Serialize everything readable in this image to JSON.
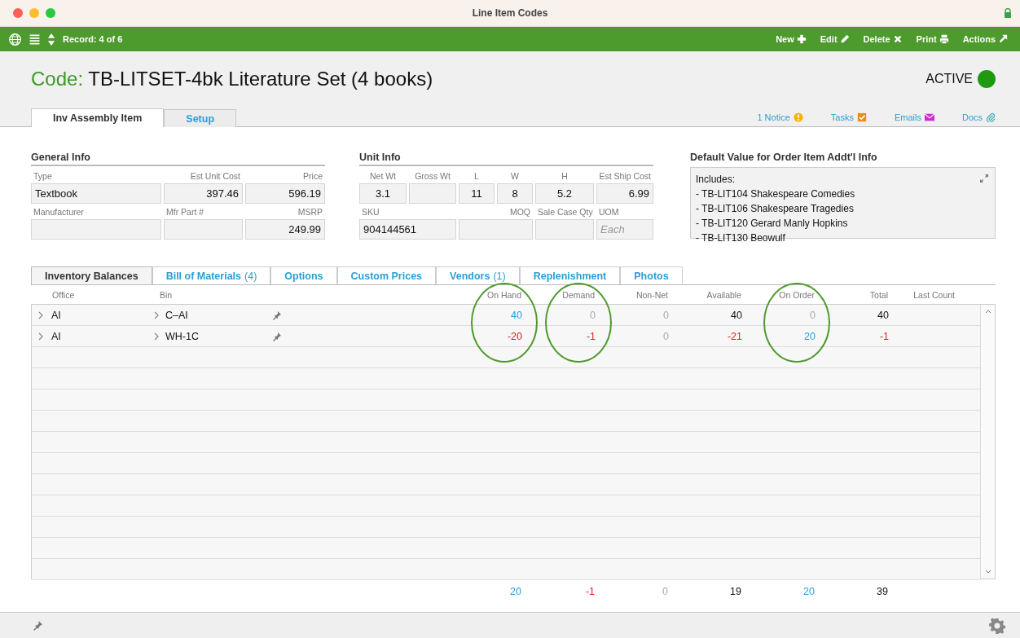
{
  "window": {
    "title": "Line Item Codes"
  },
  "toolbar": {
    "record": "Record: 4 of 6",
    "actions": [
      {
        "label": "New",
        "kind": "new"
      },
      {
        "label": "Edit",
        "kind": "edit"
      },
      {
        "label": "Delete",
        "kind": "delete"
      },
      {
        "label": "Print",
        "kind": "print"
      },
      {
        "label": "Actions",
        "kind": "actions"
      }
    ]
  },
  "header": {
    "code_label": "Code:",
    "title": "TB-LITSET-4bk Literature Set (4 books)",
    "status": {
      "label": "ACTIVE",
      "on": true
    }
  },
  "tabs": [
    {
      "label": "Inv Assembly Item",
      "selected": true
    },
    {
      "label": "Setup",
      "selected": false
    }
  ],
  "links": [
    {
      "label": "1 Notice",
      "kind": "notice"
    },
    {
      "label": "Tasks",
      "kind": "tasks"
    },
    {
      "label": "Emails",
      "kind": "emails"
    },
    {
      "label": "Docs",
      "kind": "docs"
    }
  ],
  "general_info": {
    "title": "General Info",
    "rows": [
      [
        {
          "label": "Type",
          "value": "Textbook",
          "kind": "text"
        },
        {
          "label": "Est Unit Cost",
          "value": "397.46",
          "kind": "number"
        },
        {
          "label": "Price",
          "value": "596.19",
          "kind": "number"
        }
      ],
      [
        {
          "label": "Manufacturer",
          "kind": "text"
        },
        {
          "label": "Mfr Part #",
          "kind": "text"
        },
        {
          "label": "MSRP",
          "value": "249.99",
          "kind": "number"
        }
      ]
    ]
  },
  "unit_info": {
    "title": "Unit Info",
    "fields": [
      {
        "label": "Net Wt",
        "value": "3.1",
        "kind": "measure"
      },
      {
        "label": "Gross Wt",
        "kind": "measure"
      },
      {
        "label": "L",
        "value": "11",
        "kind": "measure"
      },
      {
        "label": "W",
        "value": "8",
        "kind": "measure"
      },
      {
        "label": "H",
        "value": "5.2",
        "kind": "measure"
      },
      {
        "label": "Est Ship Cost",
        "value": "6.99",
        "kind": "number"
      },
      {
        "label": "SKU",
        "value": "904144561",
        "kind": "text"
      },
      {
        "label": "MOQ",
        "kind": "number"
      },
      {
        "label": "Sale Case Qty",
        "kind": "measure"
      },
      {
        "label": "UOM",
        "placeholder": "Each",
        "kind": "text"
      }
    ]
  },
  "order_info": {
    "title": "Default Value for Order Item Addt'l Info",
    "lines": [
      "Includes:",
      "- TB-LIT104 Shakespeare Comedies",
      "- TB-LIT106 Shakespeare Tragedies",
      "- TB-LIT120 Gerard Manly Hopkins",
      "- TB-LIT130 Beowulf"
    ]
  },
  "subtabs": [
    {
      "label": "Inventory Balances",
      "selected": true
    },
    {
      "label": "Bill of Materials",
      "count": "(4)",
      "selected": false
    },
    {
      "label": "Options",
      "selected": false
    },
    {
      "label": "Custom Prices",
      "selected": false
    },
    {
      "label": "Vendors",
      "count": "(1)",
      "selected": false
    },
    {
      "label": "Replenishment",
      "selected": false
    },
    {
      "label": "Photos",
      "selected": false
    }
  ],
  "table": {
    "columns": [
      {
        "label": "Office",
        "circled": false
      },
      {
        "label": "Bin",
        "circled": false
      },
      {
        "label": "On Hand",
        "circled": true
      },
      {
        "label": "Demand",
        "circled": true
      },
      {
        "label": "Non-Net",
        "circled": false
      },
      {
        "label": "Available",
        "circled": false
      },
      {
        "label": "On Order",
        "circled": true
      },
      {
        "label": "Total",
        "circled": false
      },
      {
        "label": "Last Count",
        "circled": false
      }
    ],
    "rows": [
      {
        "cells": [
          {
            "text": "AI",
            "kind": "plain"
          },
          {
            "text": "C–AI",
            "kind": "plain"
          },
          {
            "text": "40",
            "kind": "link"
          },
          {
            "text": "0",
            "kind": "zero"
          },
          {
            "text": "0",
            "kind": "zero"
          },
          {
            "text": "40",
            "kind": "plain"
          },
          {
            "text": "0",
            "kind": "zero"
          },
          {
            "text": "40",
            "kind": "plain"
          }
        ]
      },
      {
        "cells": [
          {
            "text": "AI",
            "kind": "plain"
          },
          {
            "text": "WH-1C",
            "kind": "plain"
          },
          {
            "text": "-20",
            "kind": "negative"
          },
          {
            "text": "-1",
            "kind": "negative"
          },
          {
            "text": "0",
            "kind": "zero"
          },
          {
            "text": "-21",
            "kind": "negative"
          },
          {
            "text": "20",
            "kind": "link"
          },
          {
            "text": "-1",
            "kind": "negative"
          }
        ]
      }
    ],
    "totals": [
      {
        "text": "20",
        "kind": "link"
      },
      {
        "text": "-1",
        "kind": "negative"
      },
      {
        "text": "0",
        "kind": "zero"
      },
      {
        "text": "19",
        "kind": "plain"
      },
      {
        "text": "20",
        "kind": "link"
      },
      {
        "text": "39",
        "kind": "plain"
      }
    ]
  }
}
